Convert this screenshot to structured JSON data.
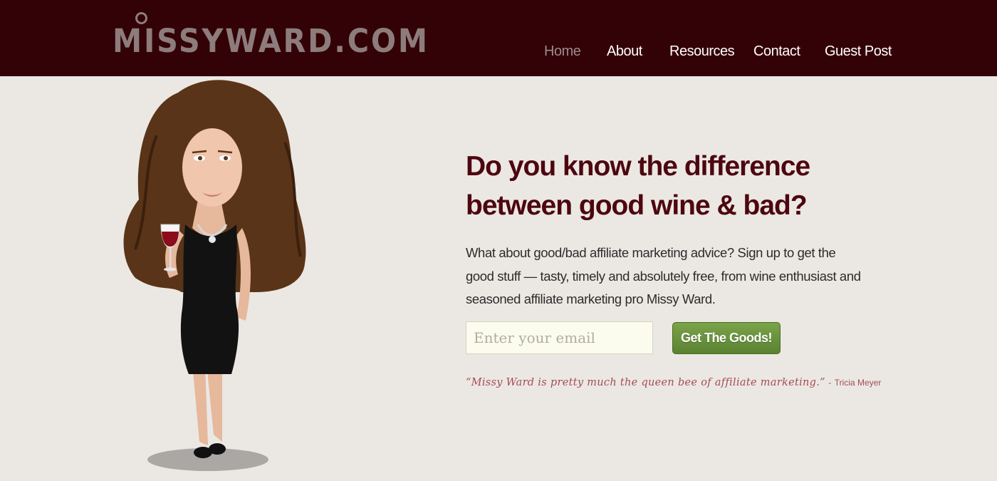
{
  "header": {
    "logo_text": "MISSYWARD.COM",
    "nav": [
      {
        "label": "Home",
        "active": true
      },
      {
        "label": "About",
        "active": false
      },
      {
        "label": "Resources",
        "active": false
      },
      {
        "label": "Contact",
        "active": false
      },
      {
        "label": "Guest Post",
        "active": false
      }
    ]
  },
  "hero": {
    "headline_line1": "Do you know the difference",
    "headline_line2": "between good wine & bad?",
    "body": "What about good/bad affiliate marketing advice? Sign up to get the good stuff — tasty, timely and absolutely free, from wine enthusiast and seasoned affiliate marketing pro Missy Ward.",
    "email_placeholder": "Enter your email",
    "email_value": "",
    "cta_label": "Get The Goods!",
    "quote_text": "“Missy Ward is pretty much the queen bee of affiliate marketing.”",
    "quote_separator": "-",
    "quote_author": "Tricia Meyer"
  },
  "colors": {
    "header_bg": "#330206",
    "page_bg": "#ebe8e3",
    "headline": "#4d0610",
    "cta_green": "#6a9340",
    "quote": "#a64b55"
  }
}
